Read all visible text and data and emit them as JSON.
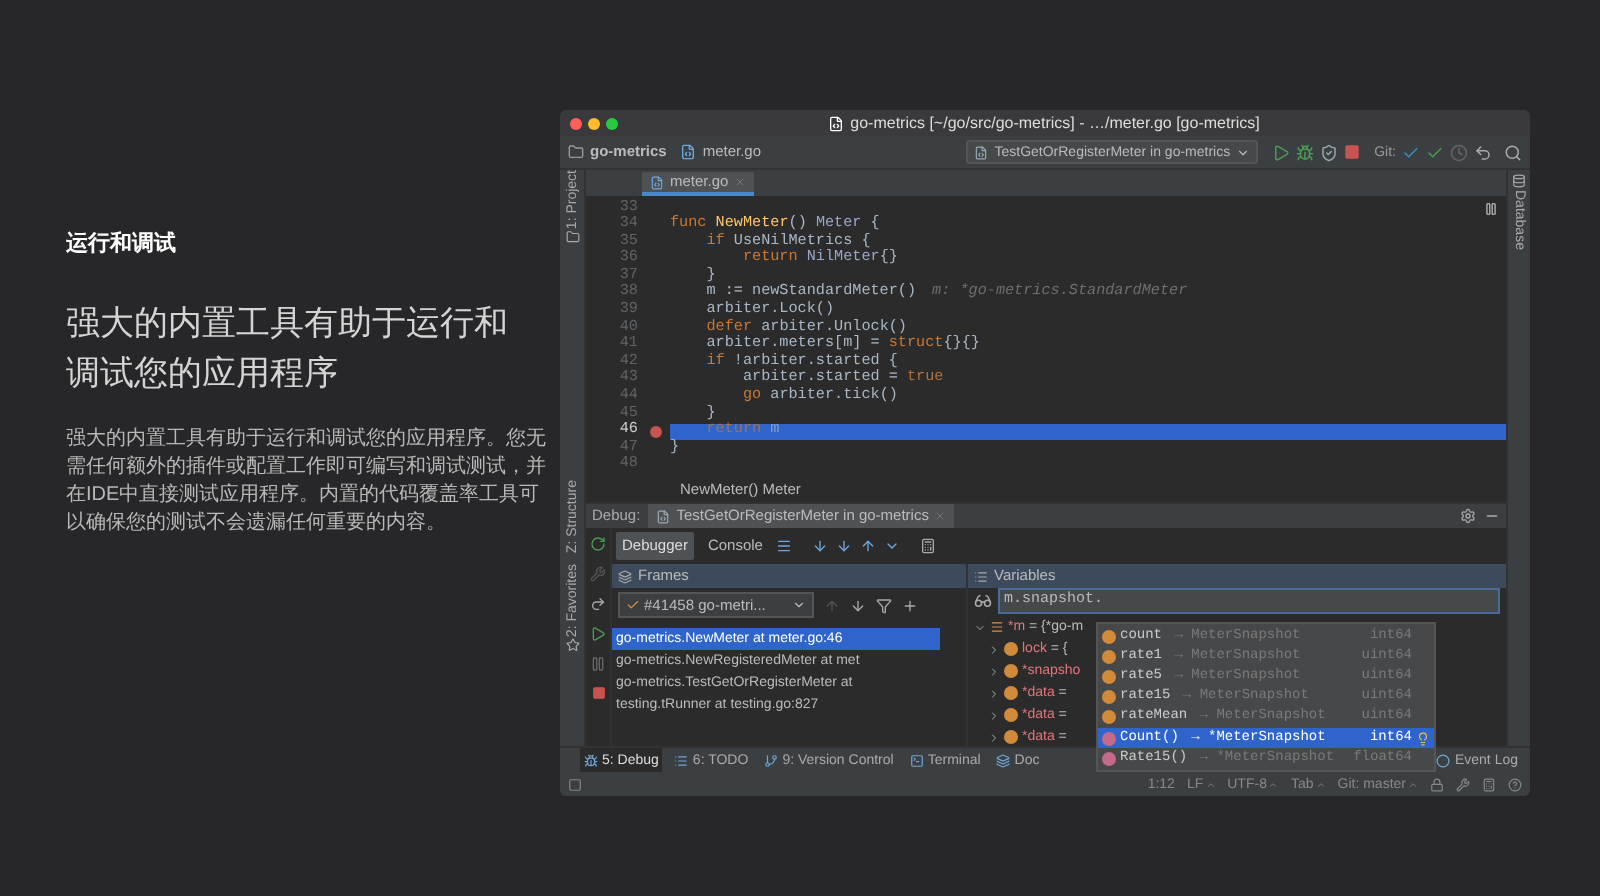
{
  "intro": {
    "section_label": "运行和调试",
    "heading": "强大的内置工具有助于运行和调试您的应用程序",
    "paragraph": "强大的内置工具有助于运行和调试您的应用程序。您无需任何额外的插件或配置工作即可编写和调试测试，并在IDE中直接测试应用程序。内置的代码覆盖率工具可以确保您的测试不会遗漏任何重要的内容。"
  },
  "window": {
    "title": "go-metrics [~/go/src/go-metrics] - …/meter.go [go-metrics]"
  },
  "navbar": {
    "project": "go-metrics",
    "file": "meter.go",
    "run_config": "TestGetOrRegisterMeter in go-metrics",
    "git_label": "Git:"
  },
  "left_tools": [
    {
      "label": "1: Project"
    },
    {
      "label": "Z: Structure"
    },
    {
      "label": "2: Favorites"
    }
  ],
  "right_tools": [
    {
      "label": "Database"
    }
  ],
  "editor": {
    "tab": "meter.go",
    "breadcrumb": "NewMeter() Meter",
    "lines": [
      {
        "number": "33",
        "breakpoint": false,
        "current": false
      },
      {
        "number": "34",
        "segments": [
          {
            "text": "func ",
            "kind": "keyword"
          },
          {
            "text": "NewMeter",
            "kind": "function"
          },
          {
            "text": "() ",
            "kind": "plain"
          },
          {
            "text": "Meter",
            "kind": "type"
          },
          {
            "text": " {",
            "kind": "plain"
          }
        ],
        "breakpoint": false,
        "current": false
      },
      {
        "number": "35",
        "segments": [
          {
            "text": "    if ",
            "kind": "keyword"
          },
          {
            "text": "UseNilMetrics {",
            "kind": "plain"
          }
        ],
        "breakpoint": false,
        "current": false
      },
      {
        "number": "36",
        "segments": [
          {
            "text": "        return ",
            "kind": "keyword"
          },
          {
            "text": "NilMeter",
            "kind": "type"
          },
          {
            "text": "{}",
            "kind": "plain"
          }
        ],
        "breakpoint": false,
        "current": false
      },
      {
        "number": "37",
        "segments": [
          {
            "text": "    }",
            "kind": "plain"
          }
        ],
        "breakpoint": false,
        "current": false
      },
      {
        "number": "38",
        "segments": [
          {
            "text": "    m := newStandardMeter()",
            "kind": "plain"
          }
        ],
        "hint": "m: *go-metrics.StandardMeter",
        "breakpoint": false,
        "current": false
      },
      {
        "number": "39",
        "segments": [
          {
            "text": "    arbiter.Lock()",
            "kind": "plain"
          }
        ],
        "breakpoint": false,
        "current": false
      },
      {
        "number": "40",
        "segments": [
          {
            "text": "    defer ",
            "kind": "keyword"
          },
          {
            "text": "arbiter.Unlock()",
            "kind": "plain"
          }
        ],
        "breakpoint": false,
        "current": false
      },
      {
        "number": "41",
        "segments": [
          {
            "text": "    arbiter.meters[m] = ",
            "kind": "plain"
          },
          {
            "text": "struct",
            "kind": "keyword"
          },
          {
            "text": "{}{}",
            "kind": "plain"
          }
        ],
        "breakpoint": false,
        "current": false
      },
      {
        "number": "42",
        "segments": [
          {
            "text": "    if ",
            "kind": "keyword"
          },
          {
            "text": "!arbiter.started {",
            "kind": "plain"
          }
        ],
        "breakpoint": false,
        "current": false
      },
      {
        "number": "43",
        "segments": [
          {
            "text": "        arbiter.started = ",
            "kind": "plain"
          },
          {
            "text": "true",
            "kind": "literal"
          }
        ],
        "breakpoint": false,
        "current": false
      },
      {
        "number": "44",
        "segments": [
          {
            "text": "        go ",
            "kind": "keyword"
          },
          {
            "text": "arbiter.tick()",
            "kind": "plain"
          }
        ],
        "breakpoint": false,
        "current": false
      },
      {
        "number": "45",
        "segments": [
          {
            "text": "    }",
            "kind": "plain"
          }
        ],
        "breakpoint": false,
        "current": false
      },
      {
        "number": "46",
        "segments": [
          {
            "text": "    return ",
            "kind": "keyword"
          },
          {
            "text": "m",
            "kind": "plain"
          }
        ],
        "breakpoint": true,
        "current": true
      },
      {
        "number": "47",
        "segments": [
          {
            "text": "}",
            "kind": "plain"
          }
        ],
        "breakpoint": false,
        "current": false
      },
      {
        "number": "48",
        "breakpoint": false,
        "current": false
      }
    ]
  },
  "debug": {
    "label": "Debug:",
    "session": "TestGetOrRegisterMeter in go-metrics",
    "tabs": [
      {
        "label": "Debugger",
        "selected": true
      },
      {
        "label": "Console",
        "selected": false
      }
    ],
    "frames_title": "Frames",
    "variables_title": "Variables",
    "thread": "#41458 go-metri...",
    "watch": "m.snapshot.",
    "frames": [
      {
        "label": "go-metrics.NewMeter at meter.go:46",
        "selected": true
      },
      {
        "label": "go-metrics.NewRegisteredMeter at met",
        "selected": false
      },
      {
        "label": "go-metrics.TestGetOrRegisterMeter at",
        "selected": false
      },
      {
        "label": "testing.tRunner at testing.go:827",
        "selected": false
      }
    ],
    "variables": [
      {
        "name": "*m",
        "value": "= {*go-m",
        "kind": "object",
        "expanded": true
      },
      {
        "name": "lock",
        "value": "= {",
        "kind": "field",
        "expanded": false
      },
      {
        "name": "*snapsho",
        "kind": "field",
        "expanded": false
      },
      {
        "name": "*data",
        "value": "=",
        "kind": "field",
        "expanded": false
      },
      {
        "name": "*data",
        "value": "=",
        "kind": "field",
        "expanded": false
      },
      {
        "name": "*data",
        "value": "=",
        "kind": "field",
        "expanded": false
      }
    ],
    "completions": [
      {
        "name": "count",
        "owner": "→ MeterSnapshot",
        "type": "int64",
        "kind": "field",
        "selected": false
      },
      {
        "name": "rate1",
        "owner": "→ MeterSnapshot",
        "type": "uint64",
        "kind": "field",
        "selected": false
      },
      {
        "name": "rate5",
        "owner": "→ MeterSnapshot",
        "type": "uint64",
        "kind": "field",
        "selected": false
      },
      {
        "name": "rate15",
        "owner": "→ MeterSnapshot",
        "type": "uint64",
        "kind": "field",
        "selected": false
      },
      {
        "name": "rateMean",
        "owner": "→ MeterSnapshot",
        "type": "uint64",
        "kind": "field",
        "selected": false
      },
      {
        "name": "Count()",
        "owner": "→ *MeterSnapshot",
        "type": "int64",
        "kind": "method",
        "selected": true
      },
      {
        "name": "Rate15()",
        "owner": "→ *MeterSnapshot",
        "type": "float64",
        "kind": "method",
        "selected": false
      }
    ]
  },
  "bottom_tabs": [
    {
      "label": "5: Debug",
      "kind": "debug",
      "selected": true
    },
    {
      "label": "6: TODO",
      "kind": "todo",
      "selected": false
    },
    {
      "label": "9: Version Control",
      "kind": "vcs",
      "selected": false
    },
    {
      "label": "Terminal",
      "kind": "terminal",
      "selected": false
    },
    {
      "label": "Doc",
      "kind": "docker",
      "selected": false
    },
    {
      "label": "Event Log",
      "kind": "log",
      "selected": false
    }
  ],
  "status_bar": {
    "position": "1:12",
    "items": [
      "LF",
      "UTF-8",
      "Tab",
      "Git: master"
    ]
  }
}
